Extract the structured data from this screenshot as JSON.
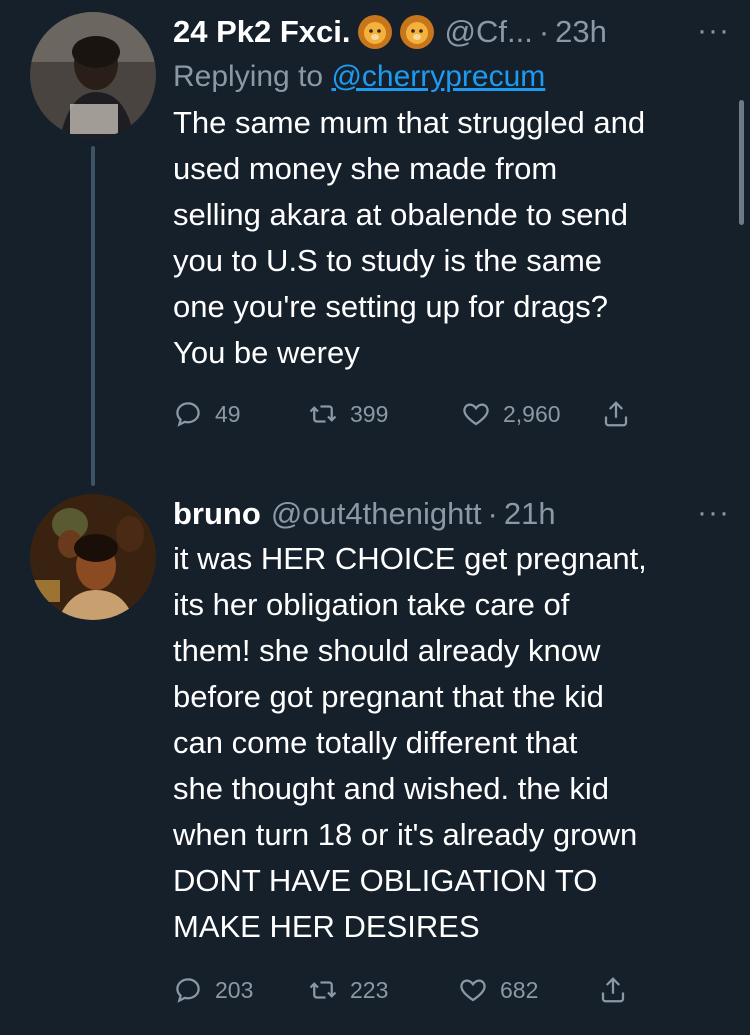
{
  "tweets": [
    {
      "display_name": "24 Pk2 Fxci.",
      "badges": [
        "lion-emoji-icon",
        "lion-emoji-icon"
      ],
      "handle": "@Cf...",
      "separator": "·",
      "time": "23h",
      "more": "···",
      "replying_prefix": "Replying to ",
      "replying_to": "@cherryprecum",
      "text": "The same mum that struggled and\nused money she made from\nselling akara at obalende to send\nyou to U.S to study is the same\none you're setting up for drags?\nYou be werey",
      "replies": "49",
      "retweets": "399",
      "likes": "2,960"
    },
    {
      "display_name": "bruno",
      "handle": "@out4thenightt",
      "separator": "·",
      "time": "21h",
      "more": "···",
      "text": "it was HER CHOICE get pregnant,\nits her obligation take care of\nthem! she should already know\nbefore got pregnant that the kid\ncan come totally different that\nshe thought and wished. the kid\nwhen turn 18 or it's already grown\nDONT HAVE OBLIGATION TO\nMAKE HER DESIRES",
      "replies": "203",
      "retweets": "223",
      "likes": "682"
    }
  ],
  "colors": {
    "background": "#15202b",
    "secondary_text": "#8b98a5",
    "link": "#1d9bf0",
    "thread_line": "#3d5466"
  }
}
